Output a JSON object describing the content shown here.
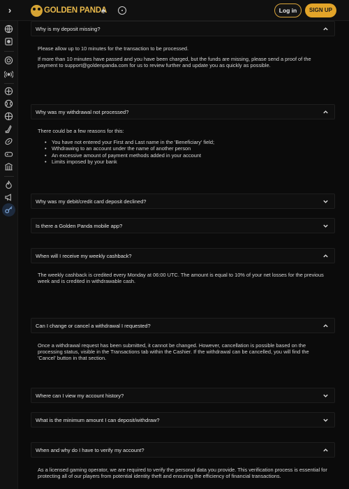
{
  "header": {
    "brand": "GOLDEN PANDA",
    "login_label": "Log in",
    "signup_label": "SIGN UP"
  },
  "faq": [
    {
      "question": "Why is my deposit missing?",
      "expanded": true,
      "answer": [
        "Please allow up to 10 minutes for the transaction to be processed.",
        "If more than 10 minutes have passed and you have been charged, but the funds are missing, please send a proof of the payment to support@goldenpanda.com for us to review further and update you as quickly as possible."
      ]
    },
    {
      "question": "Why was my withdrawal not processed?",
      "expanded": true,
      "answer": [
        "There could be a few reasons for this:"
      ],
      "bullets": [
        "You have not entered your First and Last name in the 'Beneficiary' field;",
        "Wthdrawing to an account under the name of another person",
        "An excessive amount of payment methods added in your account",
        "Limits imposed by your bank"
      ]
    },
    {
      "question": "Why was my debit/credit card deposit declined?",
      "expanded": false
    },
    {
      "question": "Is there a Golden Panda mobile app?",
      "expanded": false
    },
    {
      "question": "When will I receive my weekly cashback?",
      "expanded": true,
      "answer": [
        "The weekly cashback is credited every Monday at 06:00 UTC. The amount is equal to 10% of your net losses for the previous week and is credited in withdrawable cash."
      ]
    },
    {
      "question": "Can I change or cancel a withdrawal I requested?",
      "expanded": true,
      "answer": [
        "Once a withdrawal request has been submitted, it cannot be changed. However, cancellation is possible based on the processing status, visible in the Transactions tab within the Cashier. If the withdrawal can be cancelled, you will find the 'Cancel' button in that section."
      ]
    },
    {
      "question": "Where can I view my account history?",
      "expanded": false
    },
    {
      "question": "What is the minimum amount I can deposit/withdraw?",
      "expanded": false
    },
    {
      "question": "When and why do I have to verify my account?",
      "expanded": true,
      "answer": [
        "As a licensed gaming operator, we are required to verify the personal data you provide. This verification process is essential for protecting all of our players from potential identity theft and ensuring the efficiency of financial transactions."
      ]
    }
  ],
  "colors": {
    "accent": "#e2a429",
    "background": "#0b0b0b",
    "panel": "#0f0f0f"
  }
}
